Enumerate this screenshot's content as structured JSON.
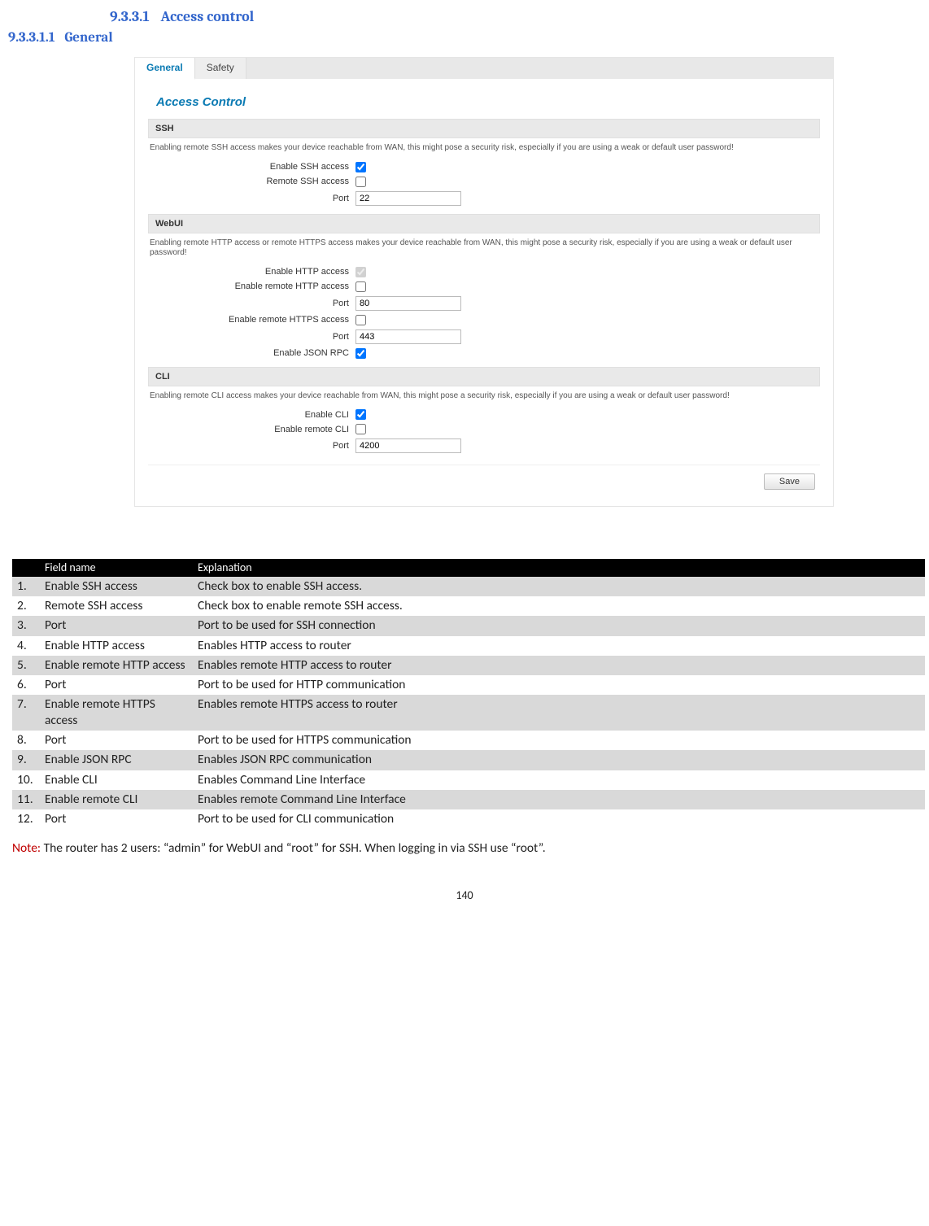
{
  "headings": {
    "h3_num": "9.3.3.1",
    "h3_text": "Access control",
    "h4_num": "9.3.3.1.1",
    "h4_text": "General"
  },
  "shot": {
    "tabs": {
      "general": "General",
      "safety": "Safety"
    },
    "title": "Access Control",
    "ssh": {
      "header": "SSH",
      "warn": "Enabling remote SSH access makes your device reachable from WAN, this might pose a security risk, especially if you are using a weak or default user password!",
      "enable_label": "Enable SSH access",
      "remote_label": "Remote SSH access",
      "port_label": "Port",
      "port_value": "22"
    },
    "webui": {
      "header": "WebUI",
      "warn": "Enabling remote HTTP access or remote HTTPS access makes your device reachable from WAN, this might pose a security risk, especially if you are using a weak or default user password!",
      "http_label": "Enable HTTP access",
      "rhttp_label": "Enable remote HTTP access",
      "http_port_label": "Port",
      "http_port_value": "80",
      "rhttps_label": "Enable remote HTTPS access",
      "https_port_label": "Port",
      "https_port_value": "443",
      "json_label": "Enable JSON RPC"
    },
    "cli": {
      "header": "CLI",
      "warn": "Enabling remote CLI access makes your device reachable from WAN, this might pose a security risk, especially if you are using a weak or default user password!",
      "enable_label": "Enable CLI",
      "remote_label": "Enable remote CLI",
      "port_label": "Port",
      "port_value": "4200"
    },
    "save": "Save"
  },
  "table": {
    "head": {
      "n": "",
      "name": "Field name",
      "expl": "Explanation"
    },
    "rows": [
      {
        "n": "1.",
        "name": "Enable SSH access",
        "expl": "Check box to enable SSH access."
      },
      {
        "n": "2.",
        "name": "Remote SSH access",
        "expl": "Check box to enable remote SSH access."
      },
      {
        "n": "3.",
        "name": "Port",
        "expl": "Port to be used for SSH connection"
      },
      {
        "n": "4.",
        "name": "Enable HTTP access",
        "expl": "Enables HTTP access to router"
      },
      {
        "n": "5.",
        "name": "Enable remote HTTP access",
        "expl": "Enables remote HTTP access to router"
      },
      {
        "n": "6.",
        "name": "Port",
        "expl": "Port to be used for HTTP communication"
      },
      {
        "n": "7.",
        "name": "Enable remote HTTPS access",
        "expl": "Enables remote HTTPS access to router"
      },
      {
        "n": "8.",
        "name": "Port",
        "expl": "Port to be used for HTTPS communication"
      },
      {
        "n": "9.",
        "name": "Enable JSON RPC",
        "expl": "Enables JSON RPC communication"
      },
      {
        "n": "10.",
        "name": "Enable CLI",
        "expl": "Enables Command Line Interface"
      },
      {
        "n": "11.",
        "name": "Enable remote CLI",
        "expl": "Enables remote Command Line Interface"
      },
      {
        "n": "12.",
        "name": "Port",
        "expl": "Port to be used for CLI communication"
      }
    ]
  },
  "note": {
    "prefix": "Note:",
    "text": " The router has 2 users: “admin” for WebUI and “root” for SSH. When logging in via SSH use “root”."
  },
  "page_number": "140"
}
